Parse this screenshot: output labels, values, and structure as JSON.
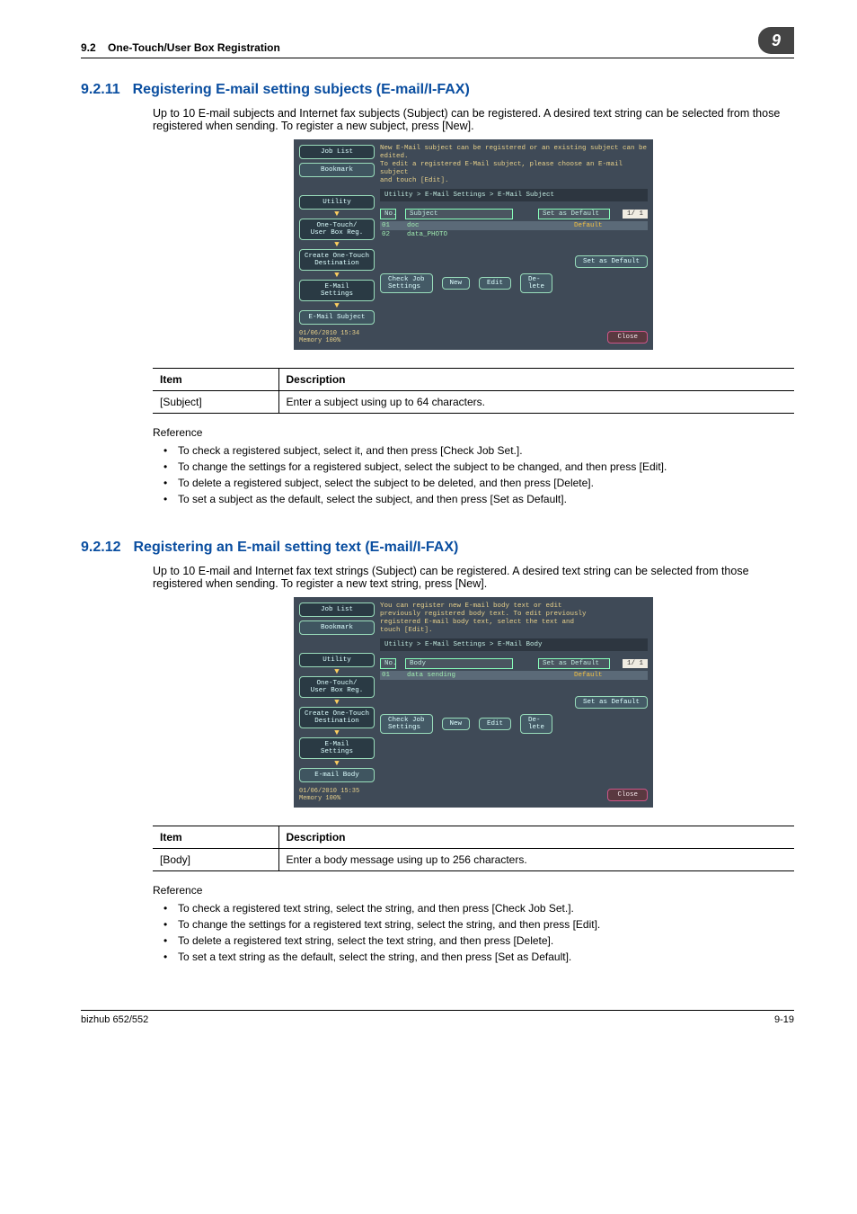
{
  "header": {
    "section_ref": "9.2",
    "title": "One-Touch/User Box Registration",
    "chapter": "9"
  },
  "sec1": {
    "num": "9.2.11",
    "title": "Registering E-mail setting subjects (E-mail/I-FAX)",
    "intro": "Up to 10 E-mail subjects and Internet fax subjects (Subject) can be registered. A desired text string can be selected from those registered when sending. To register a new subject, press [New].",
    "table": {
      "h1": "Item",
      "h2": "Description",
      "item": "[Subject]",
      "desc": "Enter a subject using up to 64 characters."
    },
    "ref_label": "Reference",
    "bullets": [
      "To check a registered subject, select it, and then press [Check Job Set.].",
      "To change the settings for a registered subject, select the subject to be changed, and then press [Edit].",
      "To delete a registered subject, select the subject to be deleted, and then press [Delete].",
      "To set a subject as the default, select the subject, and then press [Set as Default]."
    ],
    "screen": {
      "job_list": "Job List",
      "bookmark": "Bookmark",
      "utility": "Utility",
      "one_touch": "One-Touch/\nUser Box Reg.",
      "create": "Create One-Touch\nDestination",
      "email": "E-Mail\nSettings",
      "last": "E-Mail Subject",
      "hint": "New E-Mail subject can be registered or an existing subject can be edited.\nTo edit a registered E-Mail subject, please choose an E-mail subject\nand touch [Edit].",
      "crumb": "Utility > E-Mail Settings > E-Mail Subject",
      "th_no": "No.",
      "th_name": "Subject",
      "th_def": "Set as Default",
      "page": "1/  1",
      "rows": [
        {
          "no": "01",
          "name": "doc",
          "def": "Default"
        },
        {
          "no": "02",
          "name": "data_PHOTO",
          "def": ""
        }
      ],
      "set_default": "Set as Default",
      "check": "Check Job\nSettings",
      "new": "New",
      "edit": "Edit",
      "delete": "De-\nlete",
      "ts": "01/06/2010   15:34",
      "mem": "Memory       100%",
      "close": "Close"
    }
  },
  "sec2": {
    "num": "9.2.12",
    "title": "Registering an E-mail setting text (E-mail/I-FAX)",
    "intro": "Up to 10 E-mail and Internet fax text strings (Subject) can be registered. A desired text string can be selected from those registered when sending. To register a new text string, press [New].",
    "table": {
      "h1": "Item",
      "h2": "Description",
      "item": "[Body]",
      "desc": "Enter a body message using up to 256 characters."
    },
    "ref_label": "Reference",
    "bullets": [
      "To check a registered text string, select the string, and then press [Check Job Set.].",
      "To change the settings for a registered text string, select the string, and then press [Edit].",
      "To delete a registered text string, select the text string, and then press [Delete].",
      "To set a text string as the default, select the string, and then press [Set as Default]."
    ],
    "screen": {
      "job_list": "Job List",
      "bookmark": "Bookmark",
      "utility": "Utility",
      "one_touch": "One-Touch/\nUser Box Reg.",
      "create": "Create One-Touch\nDestination",
      "email": "E-Mail\nSettings",
      "last": "E-mail Body",
      "hint": "You can register new E-mail body text or edit\npreviously registered body text. To edit previously\nregistered E-mail body text, select the text and\ntouch [Edit].",
      "crumb": "Utility > E-Mail Settings > E-Mail Body",
      "th_no": "No.",
      "th_name": "Body",
      "th_def": "Set as Default",
      "page": "1/  1",
      "rows": [
        {
          "no": "01",
          "name": "data sending",
          "def": "Default"
        }
      ],
      "set_default": "Set as Default",
      "check": "Check Job\nSettings",
      "new": "New",
      "edit": "Edit",
      "delete": "De-\nlete",
      "ts": "01/06/2010   15:35",
      "mem": "Memory       100%",
      "close": "Close"
    }
  },
  "footer": {
    "left": "bizhub 652/552",
    "right": "9-19"
  }
}
